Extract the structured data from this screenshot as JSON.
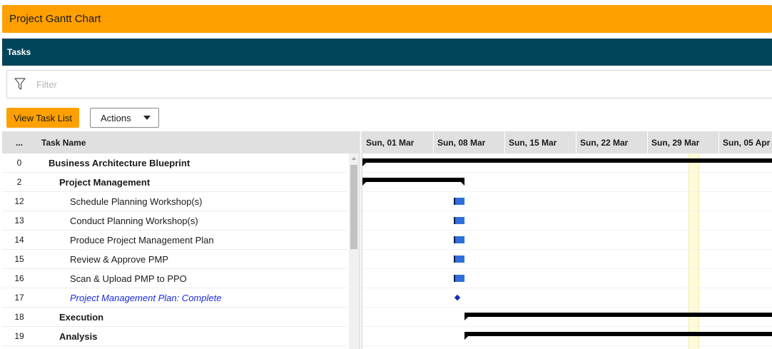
{
  "app": {
    "title": "Project Gantt Chart"
  },
  "panel": {
    "title": "Tasks"
  },
  "filter": {
    "placeholder": "Filter",
    "value": ""
  },
  "toolbar": {
    "view_task_list": "View Task List",
    "actions": "Actions"
  },
  "grid": {
    "headers": {
      "number": "...",
      "task_name": "Task Name"
    },
    "rows": [
      {
        "id": "0",
        "name": "Business Architecture Blueprint",
        "level": 0,
        "type": "summary"
      },
      {
        "id": "2",
        "name": "Project Management",
        "level": 1,
        "type": "summary"
      },
      {
        "id": "12",
        "name": "Schedule Planning Workshop(s)",
        "level": 2,
        "type": "task"
      },
      {
        "id": "13",
        "name": "Conduct Planning Workshop(s)",
        "level": 2,
        "type": "task"
      },
      {
        "id": "14",
        "name": "Produce Project Management Plan",
        "level": 2,
        "type": "task"
      },
      {
        "id": "15",
        "name": "Review & Approve PMP",
        "level": 2,
        "type": "task"
      },
      {
        "id": "16",
        "name": "Scan & Upload PMP to PPO",
        "level": 2,
        "type": "task"
      },
      {
        "id": "17",
        "name": "Project Management Plan: Complete",
        "level": 2,
        "type": "milestone"
      },
      {
        "id": "18",
        "name": "Execution",
        "level": 1,
        "type": "summary"
      },
      {
        "id": "19",
        "name": "Analysis",
        "level": 1,
        "type": "summary"
      }
    ]
  },
  "timeline": {
    "weeks": [
      "Sun, 01 Mar",
      "Sun, 08 Mar",
      "Sun, 15 Mar",
      "Sun, 22 Mar",
      "Sun, 29 Mar",
      "Sun, 05 Apr"
    ]
  },
  "colors": {
    "header_orange": "#ffa000",
    "panel_teal": "#00455a",
    "task_blue": "#2e6fdc",
    "milestone_text": "#1a2bd8",
    "today_highlight": "#fffbd8"
  }
}
